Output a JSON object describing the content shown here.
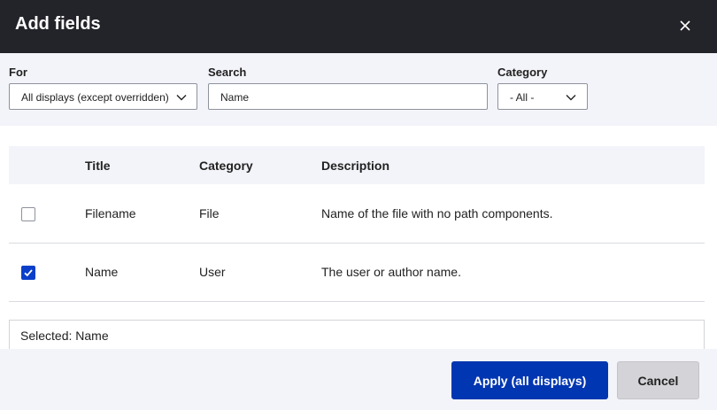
{
  "dialog": {
    "title": "Add fields"
  },
  "filters": {
    "for_label": "For",
    "for_value": "All displays (except overridden)",
    "search_label": "Search",
    "search_value": "Name",
    "category_label": "Category",
    "category_value": "- All -"
  },
  "table": {
    "headers": {
      "title": "Title",
      "category": "Category",
      "description": "Description"
    },
    "rows": [
      {
        "checked": false,
        "title": "Filename",
        "category": "File",
        "description": "Name of the file with no path components."
      },
      {
        "checked": true,
        "title": "Name",
        "category": "User",
        "description": "The user or author name."
      }
    ]
  },
  "selected_text": "Selected: Name",
  "buttons": {
    "apply": "Apply (all displays)",
    "cancel": "Cancel"
  },
  "colors": {
    "header_bg": "#232429",
    "primary": "#0036b1",
    "checkbox_checked": "#0b3fc9",
    "panel_bg": "#f3f4f9"
  }
}
